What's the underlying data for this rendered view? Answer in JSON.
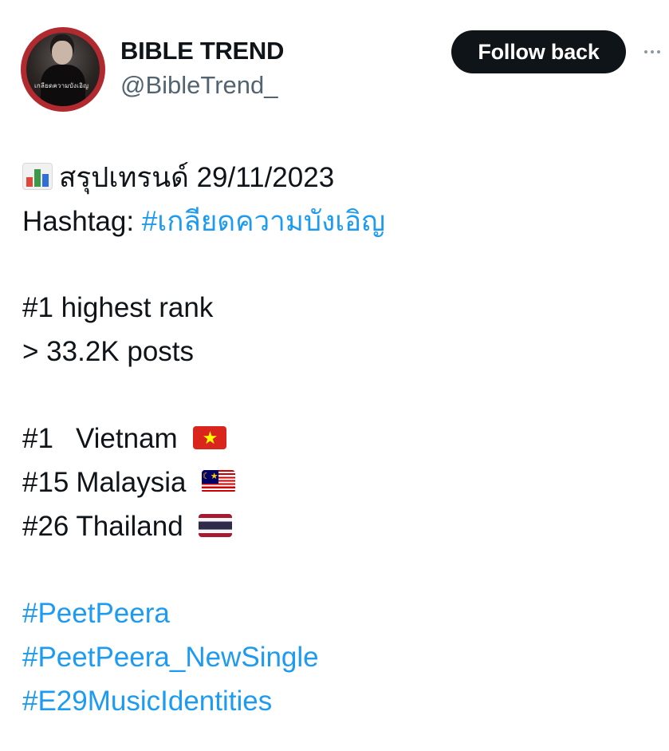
{
  "author": {
    "display_name": "BIBLE TREND",
    "handle": "@BibleTrend_",
    "avatar_caption": "เกลียดความบังเอิญ"
  },
  "actions": {
    "follow_label": "Follow back",
    "more_icon": "more-horizontal-icon"
  },
  "tweet": {
    "summary_icon": "bar-chart-emoji",
    "summary_text": "สรุปเทรนด์ 29/11/2023",
    "hashtag_label": "Hashtag: ",
    "hashtag_value": "#เกลียดความบังเอิญ",
    "highest_rank": "#1 highest rank",
    "posts": "> 33.2K posts",
    "rankings": [
      {
        "rank": "#1",
        "country": "Vietnam",
        "flag": "vietnam-flag"
      },
      {
        "rank": "#15",
        "country": "Malaysia",
        "flag": "malaysia-flag"
      },
      {
        "rank": "#26",
        "country": "Thailand",
        "flag": "thailand-flag"
      }
    ],
    "hashtags": [
      "#PeetPeera",
      "#PeetPeera_NewSingle",
      "#E29MusicIdentities"
    ]
  },
  "colors": {
    "text": "#0f1419",
    "secondary": "#536471",
    "link": "#1d9bf0",
    "button_bg": "#0f1419",
    "avatar_ring": "#b02a2f"
  }
}
